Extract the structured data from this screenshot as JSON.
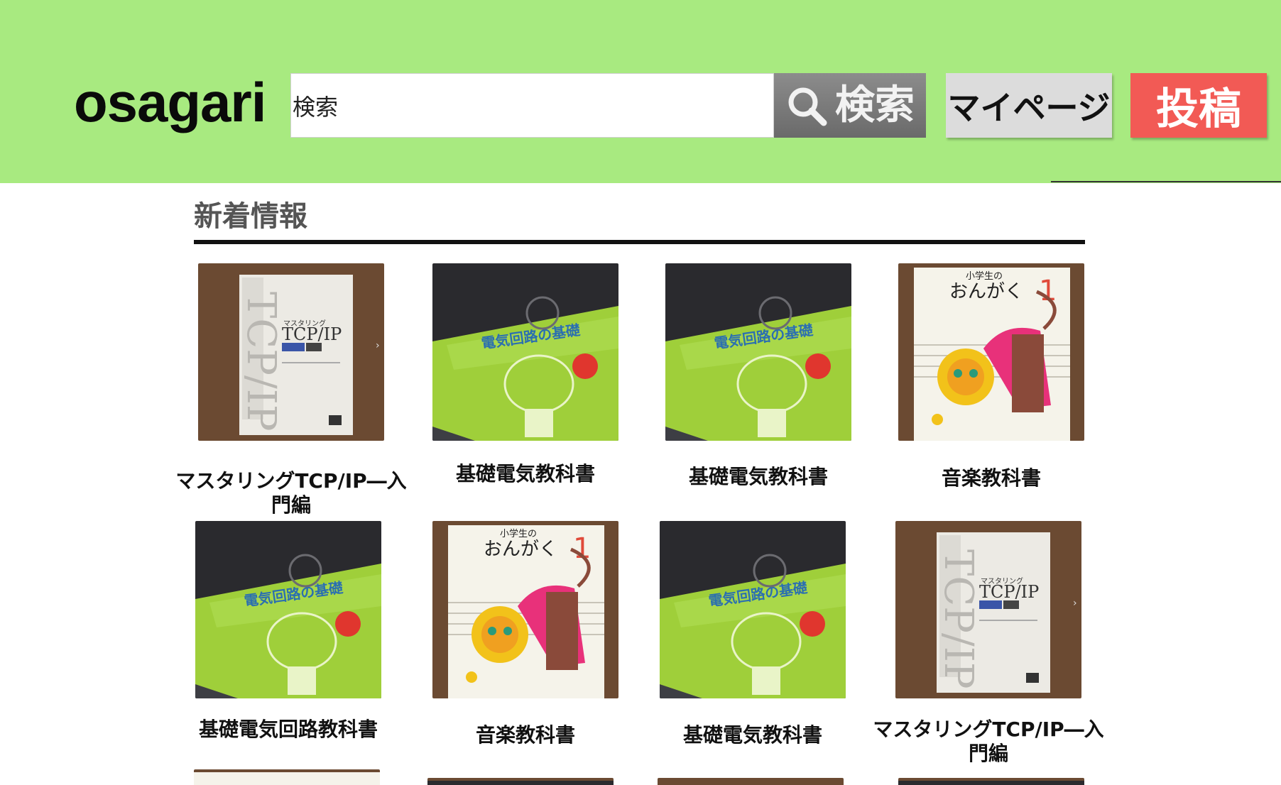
{
  "header": {
    "logo": "osagari",
    "search_value": "検索",
    "search_button_label": "検索",
    "mypage_label": "マイページ",
    "post_label": "投稿"
  },
  "section": {
    "title": "新着情報"
  },
  "items": [
    {
      "title": "マスタリングTCP/IP―入門編",
      "book": "tcp",
      "cover_title": "TCP/IP",
      "cover_sub": "マスタリング"
    },
    {
      "title": "基礎電気教科書",
      "book": "circuit",
      "cover_title": "電気回路の基礎"
    },
    {
      "title": "基礎電気教科書",
      "book": "circuit",
      "cover_title": "電気回路の基礎"
    },
    {
      "title": "音楽教科書",
      "book": "music",
      "cover_title": "おんがく",
      "cover_sub": "小学生の"
    },
    {
      "title": "基礎電気回路教科書",
      "book": "circuit",
      "cover_title": "電気回路の基礎"
    },
    {
      "title": "音楽教科書",
      "book": "music",
      "cover_title": "おんがく",
      "cover_sub": "小学生の"
    },
    {
      "title": "基礎電気教科書",
      "book": "circuit",
      "cover_title": "電気回路の基礎"
    },
    {
      "title": "マスタリングTCP/IP―入門編",
      "book": "tcp",
      "cover_title": "TCP/IP",
      "cover_sub": "マスタリング"
    }
  ],
  "colors": {
    "header_bg": "#a8ea80",
    "post_button": "#f25a55",
    "mypage_button": "#dcdcdc",
    "search_button": "#7a7a7a"
  }
}
